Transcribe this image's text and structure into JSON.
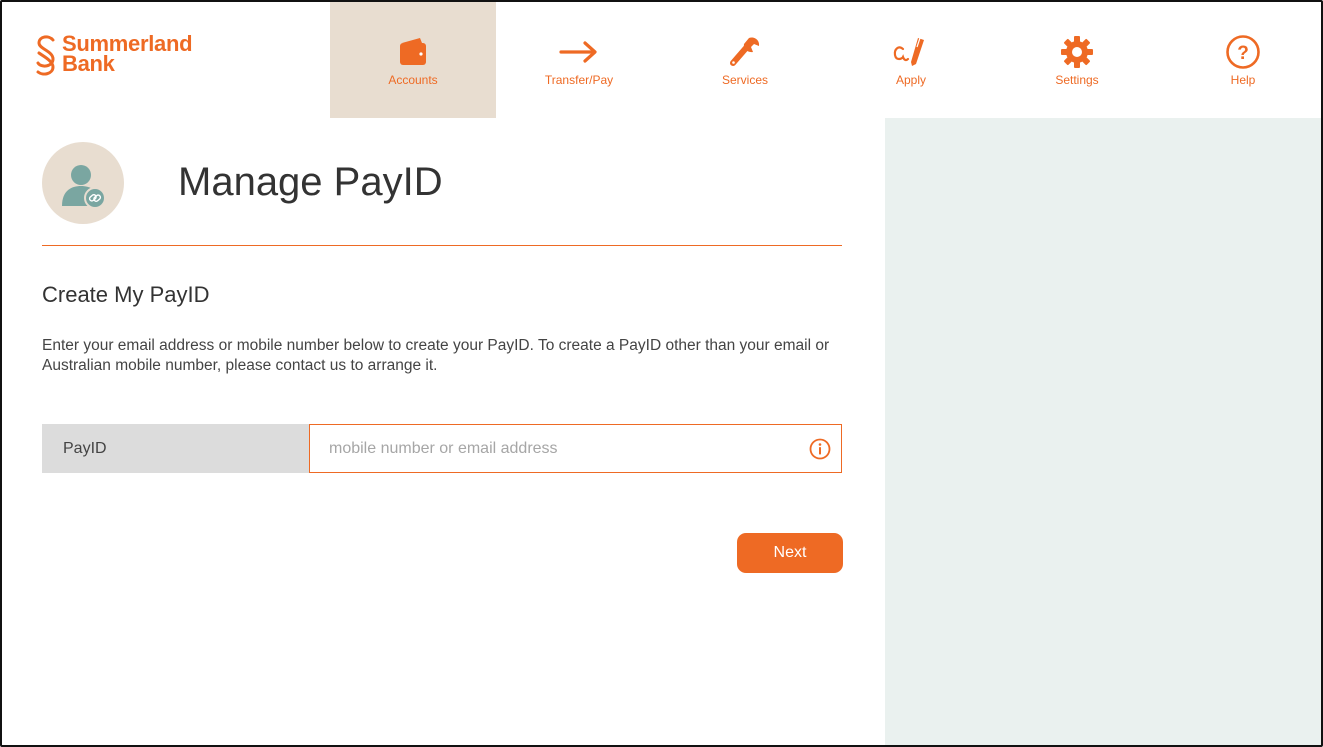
{
  "brand": {
    "line1": "Summerland",
    "line2": "Bank",
    "accent_color": "#ee6a24",
    "logo_icon": "summerland-s-icon"
  },
  "nav": {
    "items": [
      {
        "label": "Accounts",
        "icon": "wallet-icon",
        "active": true
      },
      {
        "label": "Transfer/Pay",
        "icon": "arrow-right-icon",
        "active": false
      },
      {
        "label": "Services",
        "icon": "wrench-icon",
        "active": false
      },
      {
        "label": "Apply",
        "icon": "signature-pen-icon",
        "active": false
      },
      {
        "label": "Settings",
        "icon": "gear-icon",
        "active": false
      },
      {
        "label": "Help",
        "icon": "help-circle-icon",
        "active": false
      }
    ],
    "active_bg_color": "#e8ddd0"
  },
  "page": {
    "avatar_icon": "user-link-icon",
    "title": "Manage PayID"
  },
  "form": {
    "section_title": "Create My PayID",
    "intro": "Enter your email address or mobile number below to create your PayID. To create a PayID other than your email or Australian mobile number, please contact us to arrange it.",
    "payid_label": "PayID",
    "payid_value": "",
    "payid_placeholder": "mobile number or email address",
    "info_icon": "info-icon",
    "next_label": "Next"
  },
  "colors": {
    "side_panel": "#eaf1ef",
    "field_label_bg": "#dcdcdc"
  }
}
